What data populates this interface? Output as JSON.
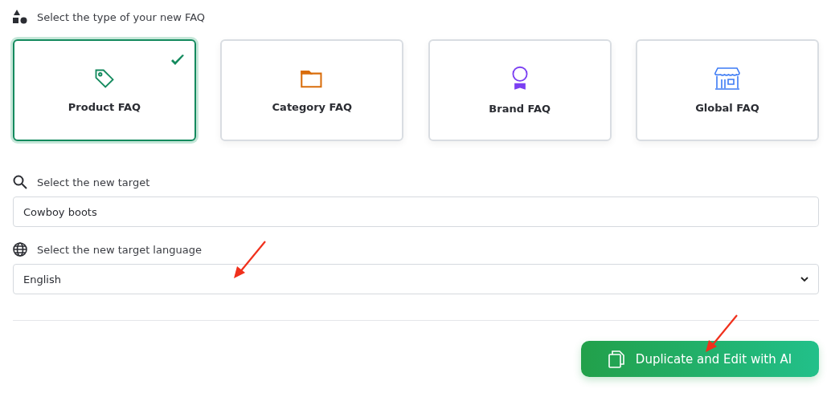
{
  "type_section": {
    "label": "Select the type of your new FAQ"
  },
  "faq_types": [
    {
      "kind": "product",
      "label": "Product FAQ",
      "selected": true
    },
    {
      "kind": "category",
      "label": "Category FAQ",
      "selected": false
    },
    {
      "kind": "brand",
      "label": "Brand FAQ",
      "selected": false
    },
    {
      "kind": "global",
      "label": "Global FAQ",
      "selected": false
    }
  ],
  "target": {
    "label": "Select the new target",
    "value": "Cowboy boots"
  },
  "language": {
    "label": "Select the new target language",
    "value": "English"
  },
  "action_button": {
    "label": "Duplicate and Edit with AI"
  }
}
